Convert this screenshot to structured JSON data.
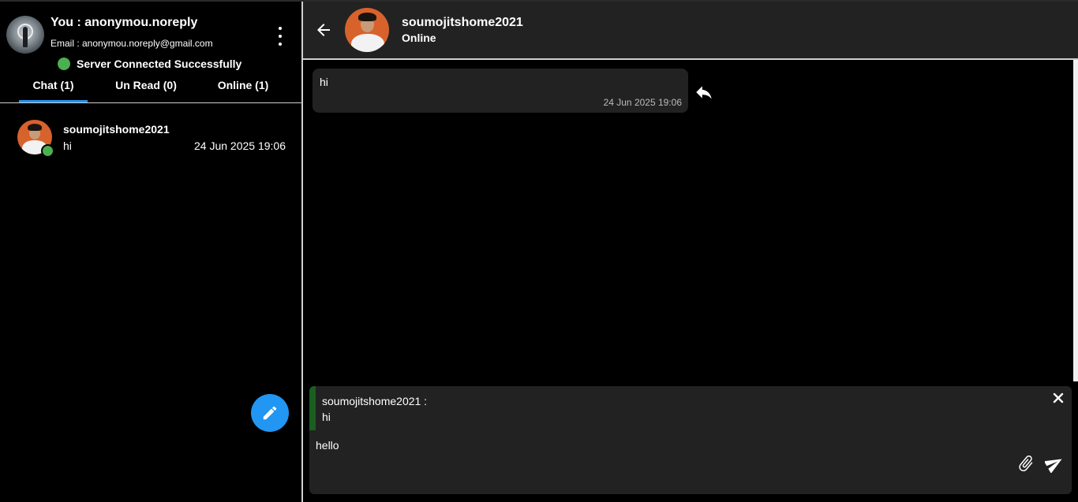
{
  "sidebar": {
    "profile": {
      "name": "You : anonymou.noreply",
      "email": "Email : anonymou.noreply@gmail.com",
      "server_status": "Server Connected Successfully",
      "status_color": "#4caf50"
    },
    "tabs": [
      {
        "label": "Chat (1)",
        "active": true
      },
      {
        "label": "Un Read (0)",
        "active": false
      },
      {
        "label": "Online (1)",
        "active": false
      }
    ],
    "chats": [
      {
        "name": "soumojitshome2021",
        "last_message": "hi",
        "time": "24 Jun 2025 19:06",
        "online": true
      }
    ],
    "accent_color": "#2196f3",
    "fab_icon": "pencil-icon"
  },
  "conversation": {
    "header": {
      "contact_name": "soumojitshome2021",
      "status": "Online",
      "back_icon": "arrow-left-icon"
    },
    "messages": [
      {
        "text": "hi",
        "time": "24 Jun 2025 19:06",
        "action_icon": "reply-icon"
      }
    ],
    "composer": {
      "quote_author": "soumojitshome2021 :",
      "quote_text": "hi",
      "input_value": "hello",
      "icons": [
        "close-icon",
        "paperclip-icon",
        "send-icon"
      ]
    }
  }
}
